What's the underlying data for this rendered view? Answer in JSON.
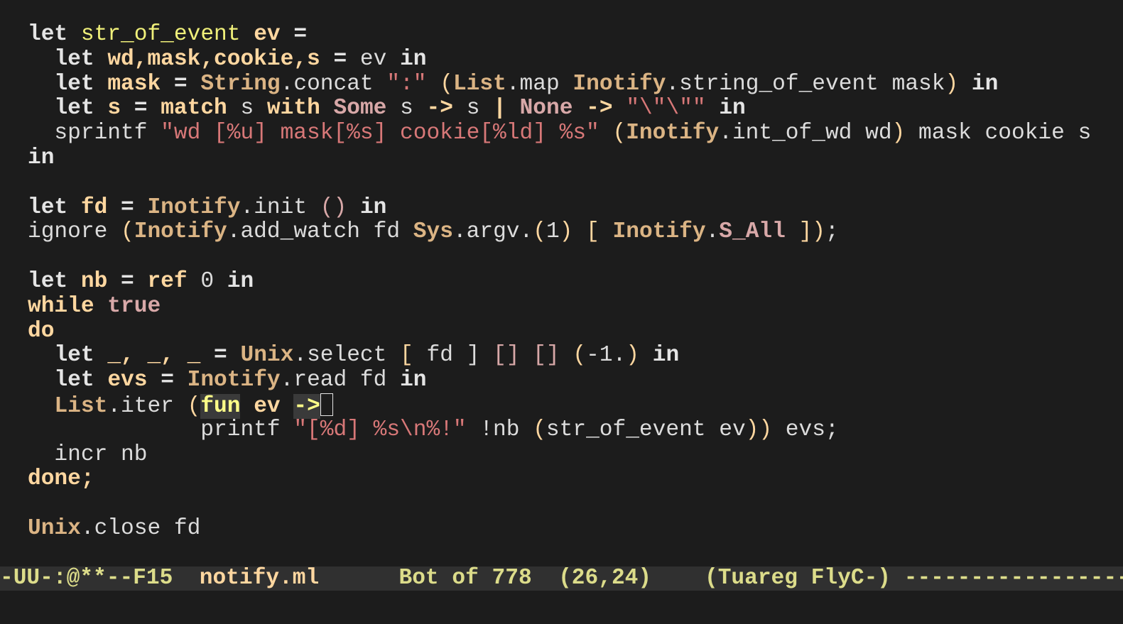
{
  "editor": {
    "mode": "Tuareg",
    "lines": [
      {
        "tokens": [
          [
            "kw",
            "let"
          ],
          [
            "plain",
            " "
          ],
          [
            "fn",
            "str_of_event"
          ],
          [
            "plain",
            " "
          ],
          [
            "var",
            "ev"
          ],
          [
            "plain",
            " "
          ],
          [
            "kw",
            "="
          ]
        ]
      },
      {
        "tokens": [
          [
            "plain",
            "  "
          ],
          [
            "kw",
            "let"
          ],
          [
            "plain",
            " "
          ],
          [
            "var",
            "wd,mask,cookie,s"
          ],
          [
            "plain",
            " "
          ],
          [
            "kw",
            "="
          ],
          [
            "plain",
            " ev "
          ],
          [
            "kw",
            "in"
          ]
        ]
      },
      {
        "tokens": [
          [
            "plain",
            "  "
          ],
          [
            "kw",
            "let"
          ],
          [
            "plain",
            " "
          ],
          [
            "var",
            "mask"
          ],
          [
            "plain",
            " "
          ],
          [
            "kw",
            "="
          ],
          [
            "plain",
            " "
          ],
          [
            "mod",
            "String"
          ],
          [
            "plain",
            ".concat "
          ],
          [
            "str",
            "\":\""
          ],
          [
            "plain",
            " "
          ],
          [
            "paren",
            "("
          ],
          [
            "mod",
            "List"
          ],
          [
            "plain",
            ".map "
          ],
          [
            "mod",
            "Inotify"
          ],
          [
            "plain",
            ".string_of_event mask"
          ],
          [
            "paren",
            ")"
          ],
          [
            "plain",
            " "
          ],
          [
            "kw",
            "in"
          ]
        ]
      },
      {
        "tokens": [
          [
            "plain",
            "  "
          ],
          [
            "kw",
            "let"
          ],
          [
            "plain",
            " "
          ],
          [
            "var",
            "s"
          ],
          [
            "plain",
            " "
          ],
          [
            "kw",
            "="
          ],
          [
            "plain",
            " "
          ],
          [
            "ctl",
            "match"
          ],
          [
            "plain",
            " s "
          ],
          [
            "ctl",
            "with"
          ],
          [
            "plain",
            " "
          ],
          [
            "ctor",
            "Some"
          ],
          [
            "plain",
            " s "
          ],
          [
            "ctl",
            "->"
          ],
          [
            "plain",
            " s "
          ],
          [
            "ctl",
            "|"
          ],
          [
            "plain",
            " "
          ],
          [
            "ctor",
            "None"
          ],
          [
            "plain",
            " "
          ],
          [
            "ctl",
            "->"
          ],
          [
            "plain",
            " "
          ],
          [
            "str",
            "\"\\\"\\\"\""
          ],
          [
            "plain",
            " "
          ],
          [
            "kw",
            "in"
          ]
        ]
      },
      {
        "tokens": [
          [
            "plain",
            "  sprintf "
          ],
          [
            "str",
            "\"wd [%u] mask[%s] cookie[%ld] %s\""
          ],
          [
            "plain",
            " "
          ],
          [
            "paren",
            "("
          ],
          [
            "mod",
            "Inotify"
          ],
          [
            "plain",
            ".int_of_wd wd"
          ],
          [
            "paren",
            ")"
          ],
          [
            "plain",
            " mask cookie s"
          ]
        ]
      },
      {
        "tokens": [
          [
            "kw",
            "in"
          ]
        ]
      },
      {
        "tokens": []
      },
      {
        "tokens": [
          [
            "kw",
            "let"
          ],
          [
            "plain",
            " "
          ],
          [
            "var",
            "fd"
          ],
          [
            "plain",
            " "
          ],
          [
            "kw",
            "="
          ],
          [
            "plain",
            " "
          ],
          [
            "mod",
            "Inotify"
          ],
          [
            "plain",
            ".init "
          ],
          [
            "bracket2",
            "()"
          ],
          [
            "plain",
            " "
          ],
          [
            "kw",
            "in"
          ]
        ]
      },
      {
        "tokens": [
          [
            "plain",
            "ignore "
          ],
          [
            "paren",
            "("
          ],
          [
            "mod",
            "Inotify"
          ],
          [
            "plain",
            ".add_watch fd "
          ],
          [
            "mod",
            "Sys"
          ],
          [
            "plain",
            ".argv."
          ],
          [
            "paren",
            "("
          ],
          [
            "plain",
            "1"
          ],
          [
            "paren",
            ")"
          ],
          [
            "plain",
            " "
          ],
          [
            "paren",
            "["
          ],
          [
            "plain",
            " "
          ],
          [
            "mod",
            "Inotify"
          ],
          [
            "plain",
            "."
          ],
          [
            "ctor",
            "S_All"
          ],
          [
            "plain",
            " "
          ],
          [
            "paren",
            "])"
          ],
          [
            "plain",
            ";"
          ]
        ]
      },
      {
        "tokens": []
      },
      {
        "tokens": [
          [
            "kw",
            "let"
          ],
          [
            "plain",
            " "
          ],
          [
            "var",
            "nb"
          ],
          [
            "plain",
            " "
          ],
          [
            "kw",
            "="
          ],
          [
            "plain",
            " "
          ],
          [
            "ctl",
            "ref"
          ],
          [
            "plain",
            " 0 "
          ],
          [
            "kw",
            "in"
          ]
        ]
      },
      {
        "tokens": [
          [
            "ctl",
            "while"
          ],
          [
            "plain",
            " "
          ],
          [
            "ctor",
            "true"
          ]
        ]
      },
      {
        "tokens": [
          [
            "ctl",
            "do"
          ]
        ]
      },
      {
        "tokens": [
          [
            "plain",
            "  "
          ],
          [
            "kw",
            "let"
          ],
          [
            "plain",
            " "
          ],
          [
            "var",
            "_, _, _"
          ],
          [
            "plain",
            " "
          ],
          [
            "kw",
            "="
          ],
          [
            "plain",
            " "
          ],
          [
            "mod",
            "Unix"
          ],
          [
            "plain",
            ".select "
          ],
          [
            "paren",
            "["
          ],
          [
            "plain",
            " fd ] "
          ],
          [
            "bracket2",
            "[]"
          ],
          [
            "plain",
            " "
          ],
          [
            "bracket2",
            "[]"
          ],
          [
            "plain",
            " "
          ],
          [
            "paren",
            "("
          ],
          [
            "plain",
            "-1."
          ],
          [
            "paren",
            ")"
          ],
          [
            "plain",
            " "
          ],
          [
            "kw",
            "in"
          ]
        ]
      },
      {
        "tokens": [
          [
            "plain",
            "  "
          ],
          [
            "kw",
            "let"
          ],
          [
            "plain",
            " "
          ],
          [
            "var",
            "evs"
          ],
          [
            "plain",
            " "
          ],
          [
            "kw",
            "="
          ],
          [
            "plain",
            " "
          ],
          [
            "mod",
            "Inotify"
          ],
          [
            "plain",
            ".read fd "
          ],
          [
            "kw",
            "in"
          ]
        ]
      },
      {
        "tokens": [
          [
            "plain",
            "  "
          ],
          [
            "mod",
            "List"
          ],
          [
            "plain",
            ".iter "
          ],
          [
            "paren",
            "("
          ],
          [
            "hl-fn",
            "fun"
          ],
          [
            "plain",
            " "
          ],
          [
            "var",
            "ev"
          ],
          [
            "plain",
            " "
          ],
          [
            "hl-fn",
            "->"
          ],
          [
            "cursor",
            ""
          ]
        ]
      },
      {
        "tokens": [
          [
            "plain",
            "             printf "
          ],
          [
            "str",
            "\"[%d] %s\\n%!\""
          ],
          [
            "plain",
            " !nb "
          ],
          [
            "paren",
            "("
          ],
          [
            "plain",
            "str_of_event ev"
          ],
          [
            "paren",
            "))"
          ],
          [
            "plain",
            " evs;"
          ]
        ]
      },
      {
        "tokens": [
          [
            "plain",
            "  incr nb"
          ]
        ]
      },
      {
        "tokens": [
          [
            "ctl",
            "done;"
          ]
        ]
      },
      {
        "tokens": []
      },
      {
        "tokens": [
          [
            "mod",
            "Unix"
          ],
          [
            "plain",
            ".close fd"
          ]
        ]
      }
    ]
  },
  "modeline": {
    "status": "-UU-:@**--F15",
    "filename": "notify.ml",
    "position": "Bot of 778",
    "cursor_pos": "(26,24)",
    "modes": "(Tuareg FlyC-)",
    "filler": "-----------------"
  }
}
